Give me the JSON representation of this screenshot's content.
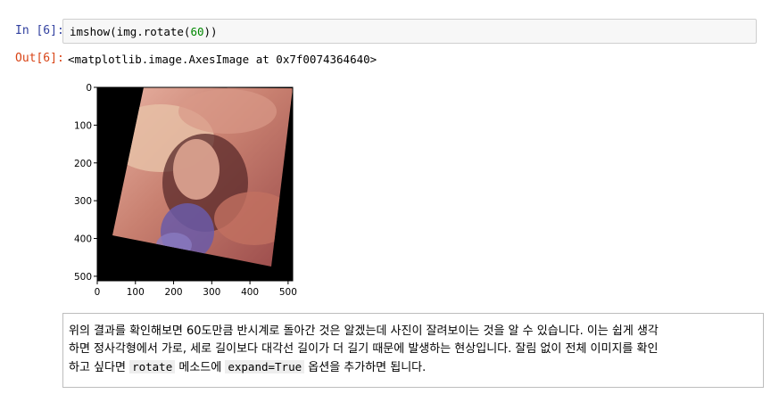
{
  "input_cell": {
    "prompt": "In [6]:",
    "code_prefix": "imshow(img.rotate(",
    "code_number": "60",
    "code_suffix": "))"
  },
  "output_cell": {
    "prompt": "Out[6]:",
    "text": "<matplotlib.image.AxesImage at 0x7f0074364640>"
  },
  "plot": {
    "x_ticks": [
      "0",
      "100",
      "200",
      "300",
      "400",
      "500"
    ],
    "y_ticks": [
      "0",
      "100",
      "200",
      "300",
      "400",
      "500"
    ],
    "colors": {
      "background": "#000000",
      "photo_warm": "#c88070",
      "photo_dark": "#5a2a2a",
      "feather": "#6a5aa8"
    }
  },
  "markdown": {
    "line1": "위의 결과를 확인해보면 60도만큼 반시계로 돌아간 것은 알겠는데 사진이 잘려보이는 것을 알 수 있습니다. 이는 쉽게 생각",
    "line2": "하면 정사각형에서 가로, 세로 길이보다 대각선 길이가 더 길기 때문에 발생하는 현상입니다. 잘림 없이 전체 이미지를 확인",
    "line3_a": "하고 싶다면 ",
    "code1": "rotate",
    "line3_b": " 메소드에 ",
    "code2": "expand=True",
    "line3_c": " 옵션을 추가하면 됩니다."
  }
}
